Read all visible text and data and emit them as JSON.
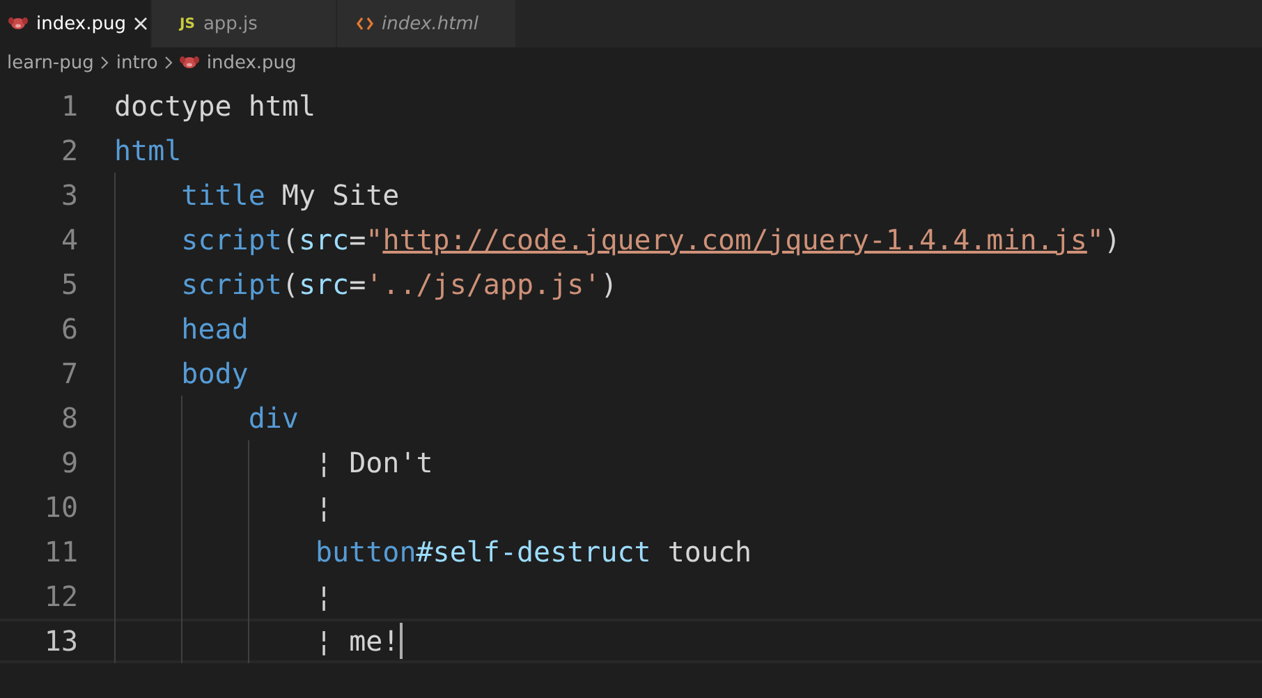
{
  "tabs": [
    {
      "label": "index.pug",
      "kind": "pug",
      "selected": true,
      "preview": false
    },
    {
      "label": "app.js",
      "kind": "js",
      "badge": "JS",
      "selected": false,
      "preview": false
    },
    {
      "label": "index.html",
      "kind": "html",
      "selected": false,
      "preview": true
    }
  ],
  "breadcrumbs": [
    {
      "label": "learn-pug",
      "kind": "folder"
    },
    {
      "label": "intro",
      "kind": "folder"
    },
    {
      "label": "index.pug",
      "kind": "pug"
    }
  ],
  "lines": [
    {
      "number": "1",
      "current": false,
      "tokens": [
        {
          "text": "doctype html",
          "kind": "plain"
        }
      ]
    },
    {
      "number": "2",
      "current": false,
      "tokens": [
        {
          "text": "html",
          "kind": "tag"
        }
      ]
    },
    {
      "number": "3",
      "current": false,
      "tokens": [
        {
          "text": "    title",
          "kind": "tag"
        },
        {
          "text": " My Site",
          "kind": "plain"
        }
      ]
    },
    {
      "number": "4",
      "current": false,
      "tokens": [
        {
          "text": "    script",
          "kind": "tag"
        },
        {
          "text": "(",
          "kind": "plain"
        },
        {
          "text": "src",
          "kind": "attr"
        },
        {
          "text": "=",
          "kind": "plain"
        },
        {
          "text": "\"",
          "kind": "string"
        },
        {
          "text": "http://code.jquery.com/jquery-1.4.4.min.js",
          "kind": "link"
        },
        {
          "text": "\"",
          "kind": "string"
        },
        {
          "text": ")",
          "kind": "plain"
        }
      ]
    },
    {
      "number": "5",
      "current": false,
      "tokens": [
        {
          "text": "    script",
          "kind": "tag"
        },
        {
          "text": "(",
          "kind": "plain"
        },
        {
          "text": "src",
          "kind": "attr"
        },
        {
          "text": "=",
          "kind": "plain"
        },
        {
          "text": "'../js/app.js'",
          "kind": "string"
        },
        {
          "text": ")",
          "kind": "plain"
        }
      ]
    },
    {
      "number": "6",
      "current": false,
      "tokens": [
        {
          "text": "    head",
          "kind": "tag"
        }
      ]
    },
    {
      "number": "7",
      "current": false,
      "tokens": [
        {
          "text": "    body",
          "kind": "tag"
        }
      ]
    },
    {
      "number": "8",
      "current": false,
      "tokens": [
        {
          "text": "        div",
          "kind": "tag"
        }
      ]
    },
    {
      "number": "9",
      "current": false,
      "tokens": [
        {
          "text": "            ¦ Don't",
          "kind": "plain"
        }
      ]
    },
    {
      "number": "10",
      "current": false,
      "tokens": [
        {
          "text": "            ¦",
          "kind": "plain"
        }
      ]
    },
    {
      "number": "11",
      "current": false,
      "tokens": [
        {
          "text": "            button",
          "kind": "tag"
        },
        {
          "text": "#self-destruct",
          "kind": "attr"
        },
        {
          "text": " touch",
          "kind": "plain"
        }
      ]
    },
    {
      "number": "12",
      "current": false,
      "tokens": [
        {
          "text": "            ¦",
          "kind": "plain"
        }
      ]
    },
    {
      "number": "13",
      "current": true,
      "tokens": [
        {
          "text": "            ¦ me!",
          "kind": "plain"
        }
      ]
    }
  ]
}
